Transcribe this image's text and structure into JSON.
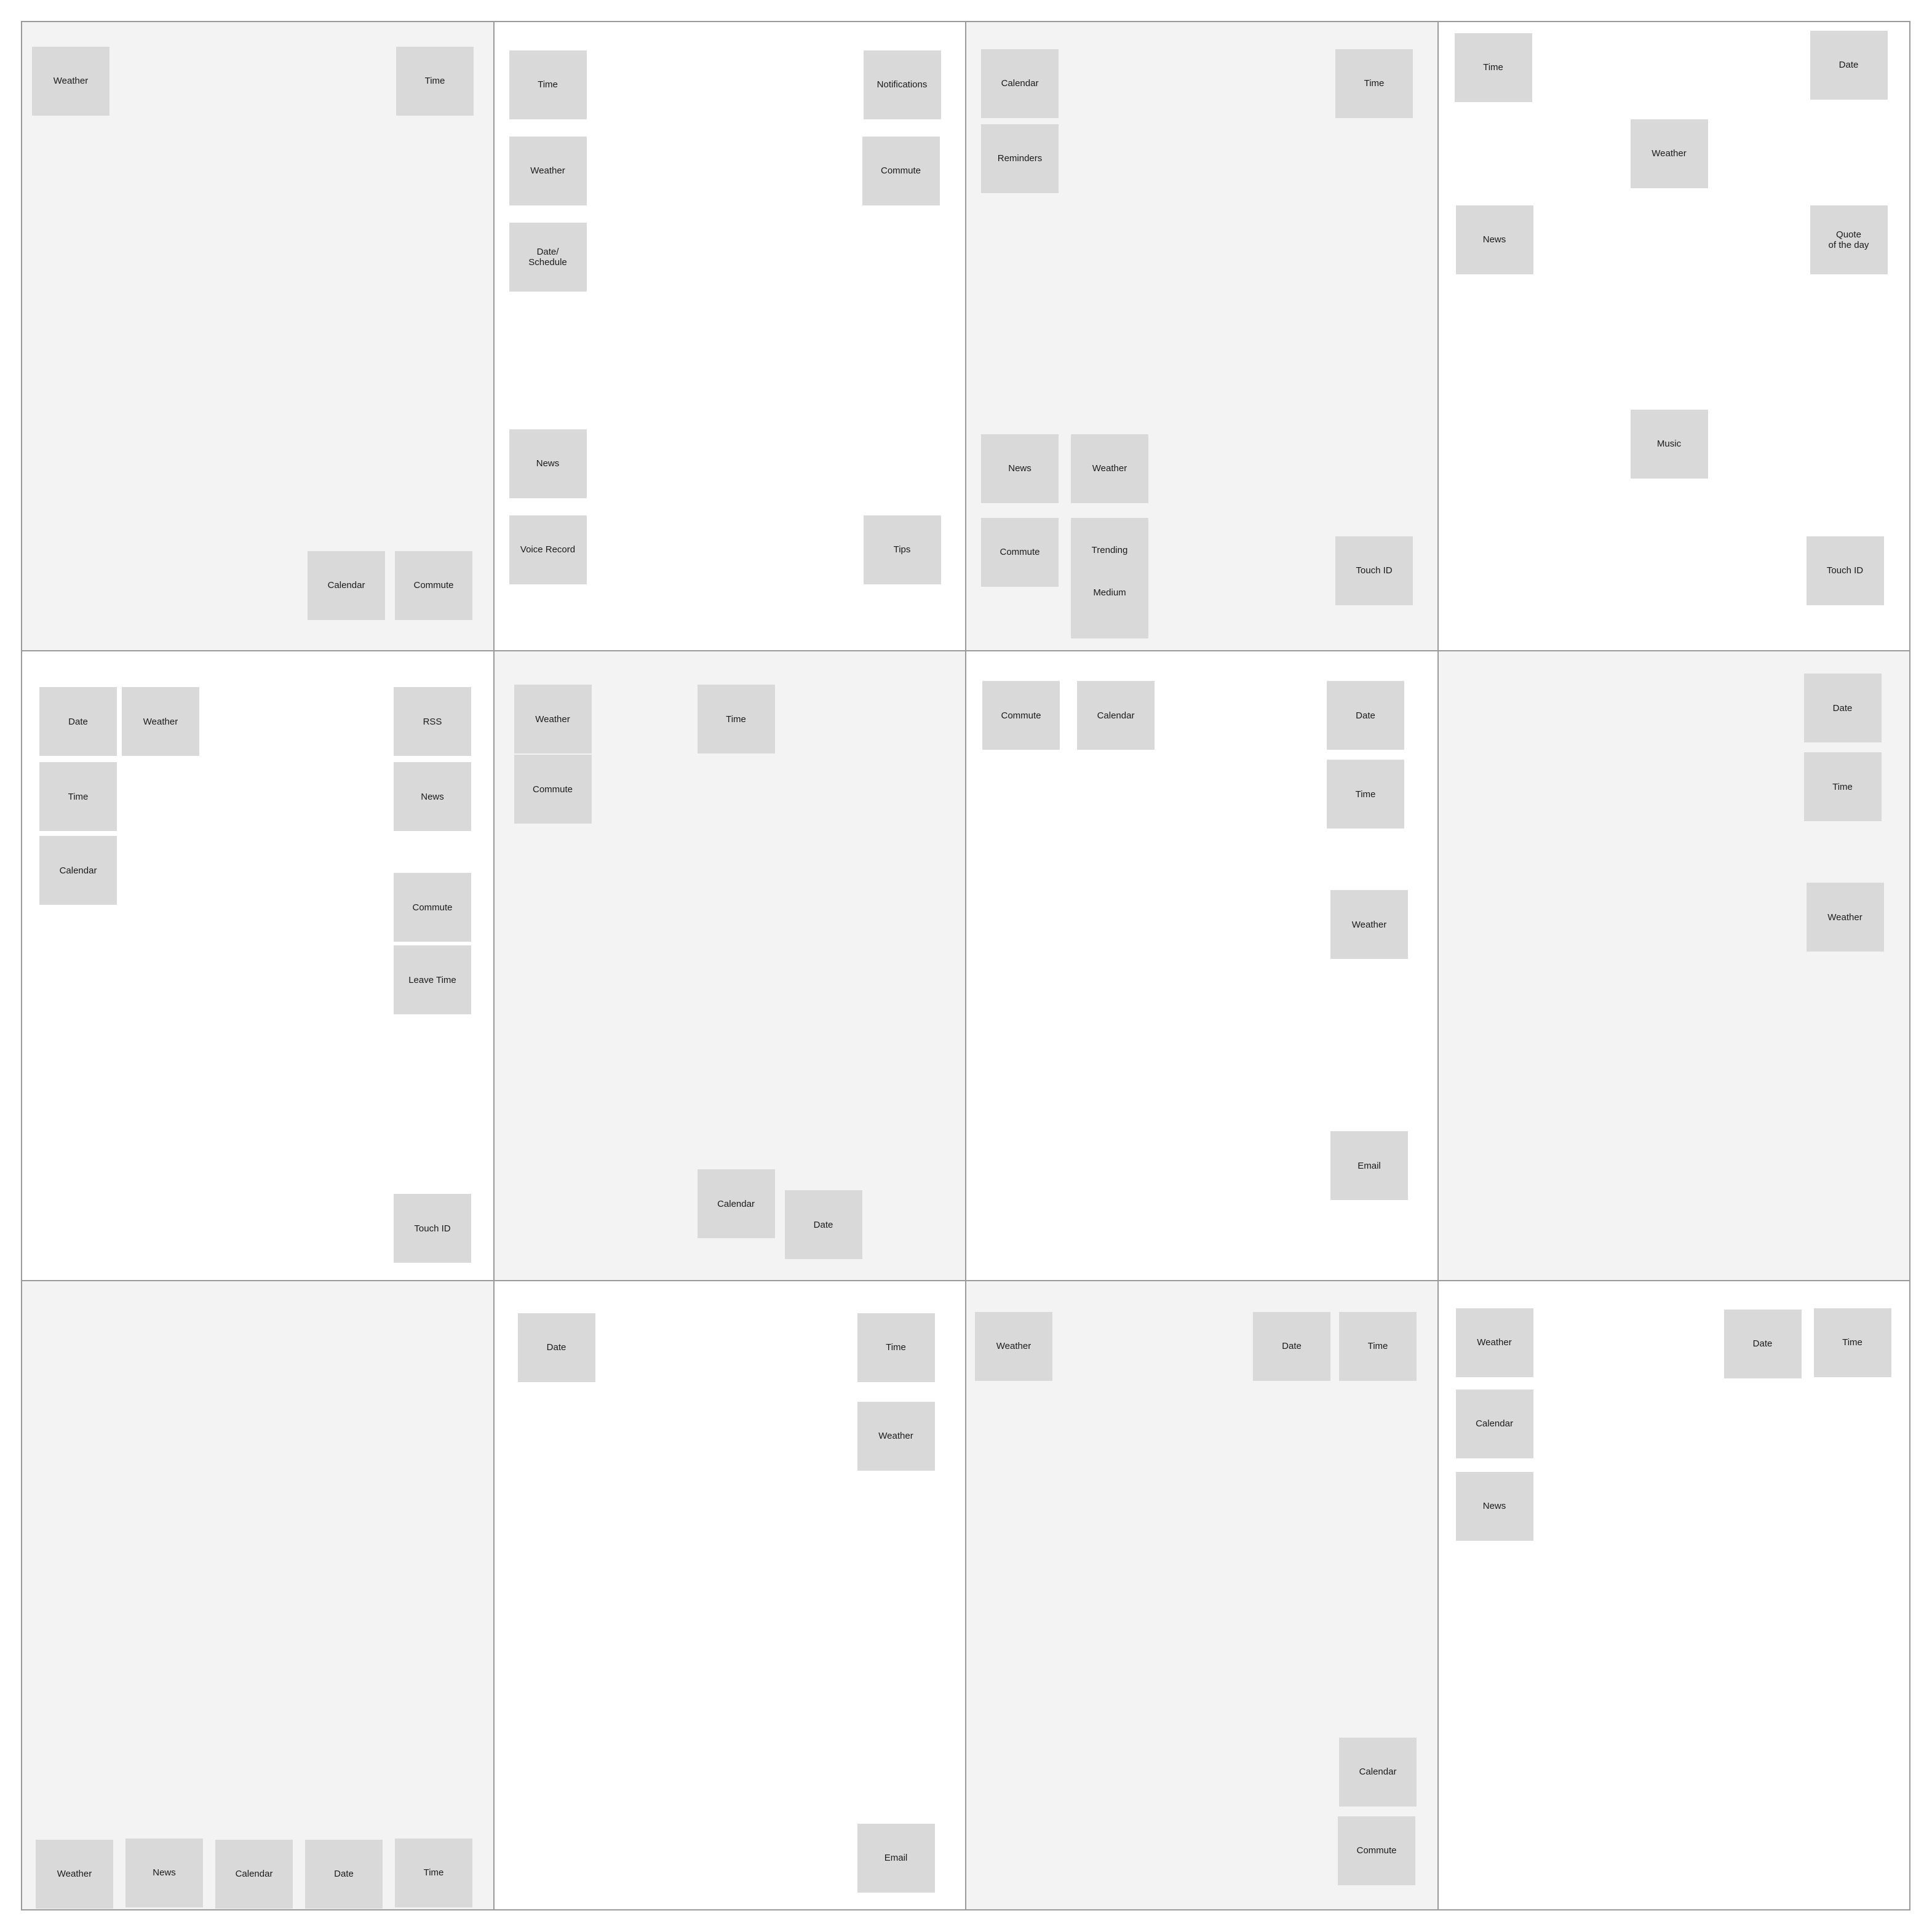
{
  "panels": [
    {
      "id": "layout-1",
      "shaded": true,
      "widgets": [
        {
          "label": "Weather"
        },
        {
          "label": "Time"
        },
        {
          "label": "Calendar"
        },
        {
          "label": "Commute"
        }
      ]
    },
    {
      "id": "layout-2",
      "shaded": false,
      "widgets": [
        {
          "label": "Time"
        },
        {
          "label": "Notifications"
        },
        {
          "label": "Weather"
        },
        {
          "label": "Commute"
        },
        {
          "label": "Date/\nSchedule"
        },
        {
          "label": "News"
        },
        {
          "label": "Voice Record"
        },
        {
          "label": "Tips"
        }
      ]
    },
    {
      "id": "layout-3",
      "shaded": true,
      "widgets": [
        {
          "label": "Calendar"
        },
        {
          "label": "Time"
        },
        {
          "label": "Reminders"
        },
        {
          "label": "News"
        },
        {
          "label": "Weather"
        },
        {
          "label": "Commute"
        },
        {
          "label": "Trending"
        },
        {
          "label": "Medium"
        },
        {
          "label": "Touch ID"
        }
      ]
    },
    {
      "id": "layout-4",
      "shaded": false,
      "widgets": [
        {
          "label": "Time"
        },
        {
          "label": "Date"
        },
        {
          "label": "Weather"
        },
        {
          "label": "News"
        },
        {
          "label": "Quote\nof the day"
        },
        {
          "label": "Music"
        },
        {
          "label": "Touch ID"
        }
      ]
    },
    {
      "id": "layout-5",
      "shaded": false,
      "widgets": [
        {
          "label": "Date"
        },
        {
          "label": "Weather"
        },
        {
          "label": "RSS"
        },
        {
          "label": "Time"
        },
        {
          "label": "News"
        },
        {
          "label": "Calendar"
        },
        {
          "label": "Commute"
        },
        {
          "label": "Leave Time"
        },
        {
          "label": "Touch ID"
        }
      ]
    },
    {
      "id": "layout-6",
      "shaded": true,
      "widgets": [
        {
          "label": "Weather"
        },
        {
          "label": "Time"
        },
        {
          "label": "Commute"
        },
        {
          "label": "Calendar"
        },
        {
          "label": "Date"
        }
      ]
    },
    {
      "id": "layout-7",
      "shaded": false,
      "widgets": [
        {
          "label": "Commute"
        },
        {
          "label": "Calendar"
        },
        {
          "label": "Date"
        },
        {
          "label": "Time"
        },
        {
          "label": "Weather"
        },
        {
          "label": "Email"
        }
      ]
    },
    {
      "id": "layout-8",
      "shaded": true,
      "widgets": [
        {
          "label": "Date"
        },
        {
          "label": "Time"
        },
        {
          "label": "Weather"
        }
      ]
    },
    {
      "id": "layout-9",
      "shaded": true,
      "widgets": [
        {
          "label": "Weather"
        },
        {
          "label": "News"
        },
        {
          "label": "Calendar"
        },
        {
          "label": "Date"
        },
        {
          "label": "Time"
        }
      ]
    },
    {
      "id": "layout-10",
      "shaded": false,
      "widgets": [
        {
          "label": "Date"
        },
        {
          "label": "Time"
        },
        {
          "label": "Weather"
        },
        {
          "label": "Email"
        }
      ]
    },
    {
      "id": "layout-11",
      "shaded": true,
      "widgets": [
        {
          "label": "Weather"
        },
        {
          "label": "Date"
        },
        {
          "label": "Time"
        },
        {
          "label": "Calendar"
        },
        {
          "label": "Commute"
        }
      ]
    },
    {
      "id": "layout-12",
      "shaded": false,
      "widgets": [
        {
          "label": "Weather"
        },
        {
          "label": "Date"
        },
        {
          "label": "Time"
        },
        {
          "label": "Calendar"
        },
        {
          "label": "News"
        }
      ]
    }
  ]
}
